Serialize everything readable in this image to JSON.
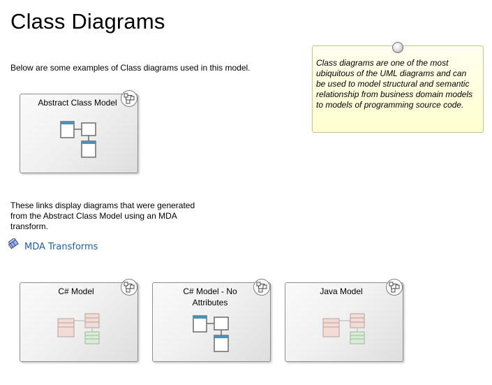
{
  "page": {
    "title": "Class Diagrams",
    "intro": "Below are some examples of Class diagrams used in this model.",
    "links_text_line1": "These links display diagrams that were generated",
    "links_text_line2": "from the Abstract Class Model using an MDA",
    "links_text_line3": "transform."
  },
  "note": {
    "line1": "Class diagrams are one of the most",
    "line2": "ubiquitous of the UML diagrams and can",
    "line3": "be used to model structural and semantic",
    "line4": "relationship from business domain models",
    "line5": "to models of programming source code."
  },
  "link": {
    "label": "MDA Transforms"
  },
  "diagrams": {
    "abstract": {
      "label": "Abstract Class Model"
    },
    "csharp": {
      "label": "C# Model"
    },
    "csharp_no_attr_line1": "C# Model - No",
    "csharp_no_attr_line2": "Attributes",
    "java": {
      "label": "Java Model"
    }
  },
  "colors": {
    "note_bg": "#ffffcf",
    "link": "#1f5f9f",
    "class_header": "#4f8fb5",
    "pink_class": "#f3dcd6",
    "green_class": "#d8ecd6"
  }
}
